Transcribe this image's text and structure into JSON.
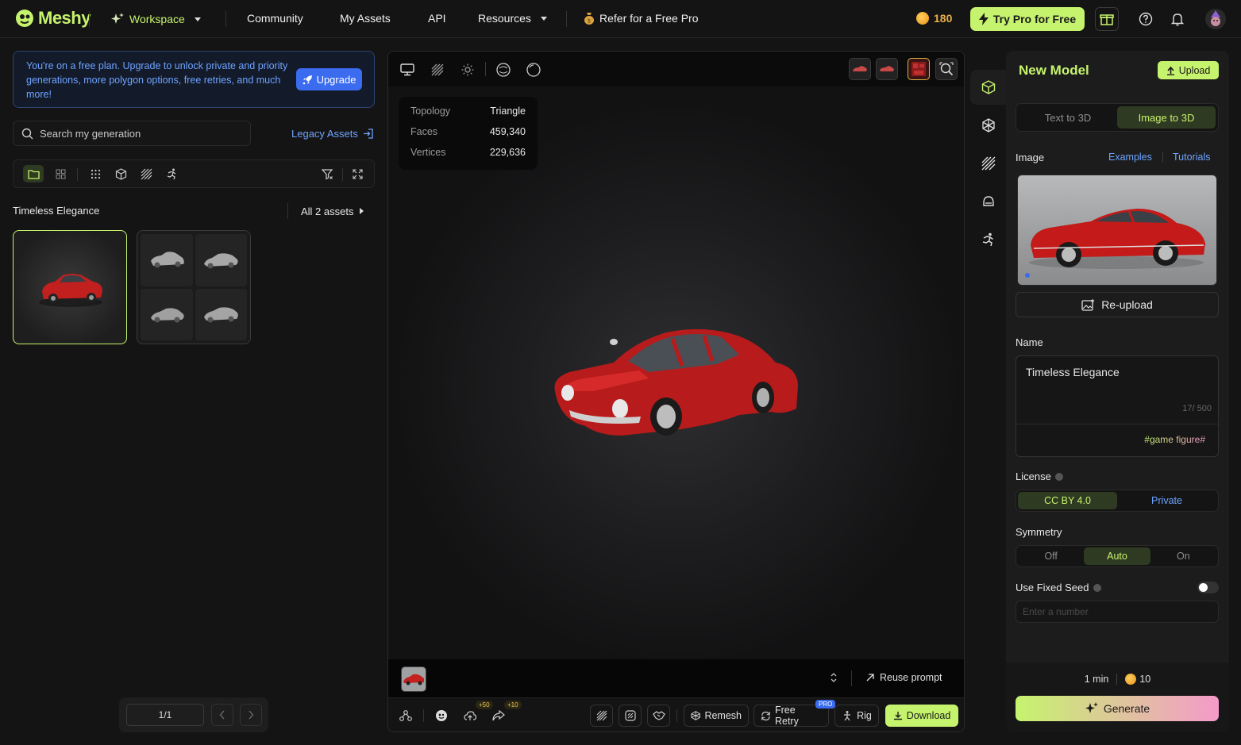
{
  "nav": {
    "brand": "Meshy",
    "workspace": "Workspace",
    "community": "Community",
    "my_assets": "My Assets",
    "api": "API",
    "resources": "Resources",
    "refer": "Refer for a Free Pro",
    "credits": "180",
    "try_pro": "Try Pro for Free"
  },
  "left": {
    "upgrade_text": "You're on a free plan. Upgrade to unlock private and priority generations, more polygon options, free retries, and much more!",
    "upgrade_button": "Upgrade",
    "search_placeholder": "Search my generation",
    "legacy_assets": "Legacy Assets",
    "section_title": "Timeless Elegance",
    "all_assets": "All 2 assets",
    "pager": "1/1"
  },
  "viewer": {
    "stats": [
      {
        "label": "Topology",
        "value": "Triangle"
      },
      {
        "label": "Faces",
        "value": "459,340"
      },
      {
        "label": "Vertices",
        "value": "229,636"
      }
    ],
    "reuse_prompt": "Reuse prompt",
    "badge_upload": "+50",
    "badge_share": "+10",
    "remesh": "Remesh",
    "free_retry": "Free Retry",
    "pro_badge": "PRO",
    "rig": "Rig",
    "download": "Download"
  },
  "panel": {
    "title": "New Model",
    "upload": "Upload",
    "tabs": [
      {
        "label": "Text to 3D",
        "active": false
      },
      {
        "label": "Image to 3D",
        "active": true
      }
    ],
    "image_label": "Image",
    "examples": "Examples",
    "tutorials": "Tutorials",
    "reupload": "Re-upload",
    "name_label": "Name",
    "name_value": "Timeless Elegance",
    "name_count": "17/ 500",
    "tag": "#game figure#",
    "license_label": "License",
    "license_options": [
      {
        "label": "CC BY 4.0",
        "active": true
      },
      {
        "label": "Private",
        "active": false
      }
    ],
    "symmetry_label": "Symmetry",
    "symmetry_options": [
      {
        "label": "Off",
        "active": false
      },
      {
        "label": "Auto",
        "active": true
      },
      {
        "label": "On",
        "active": false
      }
    ],
    "fixed_seed_label": "Use Fixed Seed",
    "seed_placeholder": "Enter a number",
    "time_estimate": "1 min",
    "cost": "10",
    "generate": "Generate"
  },
  "colors": {
    "accent": "#c6f36d",
    "link": "#6ea3ff",
    "upgrade": "#3b6cf0",
    "pink": "#f59ac9"
  }
}
